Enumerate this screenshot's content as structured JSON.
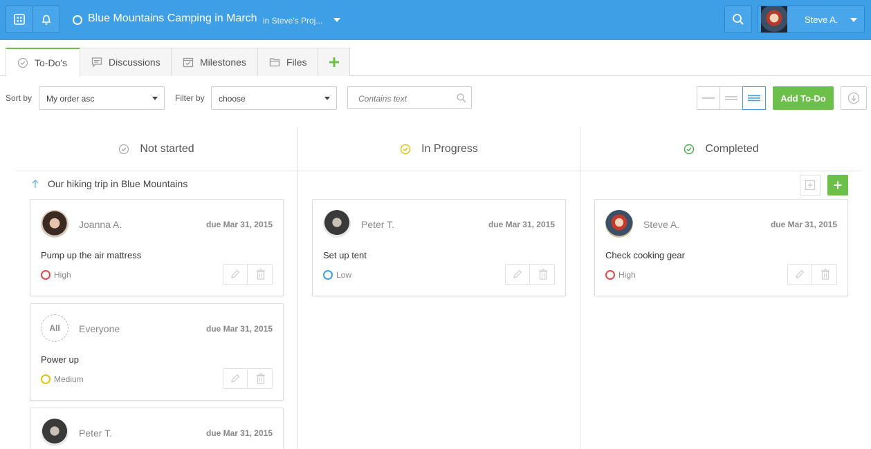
{
  "topbar": {
    "project_title": "Blue Mountains Camping in March",
    "project_sub": "in Steve's Proj...",
    "user_name": "Steve A."
  },
  "tabs": [
    {
      "label": "To-Do's",
      "icon": "check-circle-icon"
    },
    {
      "label": "Discussions",
      "icon": "chat-icon"
    },
    {
      "label": "Milestones",
      "icon": "calendar-icon"
    },
    {
      "label": "Files",
      "icon": "folder-icon"
    }
  ],
  "filters": {
    "sort_label": "Sort by",
    "sort_value": "My order asc",
    "filter_label": "Filter by",
    "filter_value": "choose",
    "search_placeholder": "Contains text",
    "add_todo_label": "Add To-Do"
  },
  "columns": [
    {
      "label": "Not started",
      "icon_color": "#aaaaaa"
    },
    {
      "label": "In Progress",
      "icon_color": "#e2c30f"
    },
    {
      "label": "Completed",
      "icon_color": "#4cae4c"
    }
  ],
  "group": {
    "title": "Our hiking trip in Blue Mountains"
  },
  "cards": [
    {
      "assignee": "Joanna A.",
      "due": "due Mar 31, 2015",
      "title": "Pump up the air mattress",
      "priority": "High",
      "priority_color": "#e24a4a"
    },
    {
      "assignee": "Everyone",
      "avatar_text": "All",
      "due": "due Mar 31, 2015",
      "title": "Power up",
      "priority": "Medium",
      "priority_color": "#e2c30f"
    },
    {
      "assignee": "Peter T.",
      "due": "due Mar 31, 2015"
    },
    {
      "assignee": "Peter T.",
      "due": "due Mar 31, 2015",
      "title": "Set up tent",
      "priority": "Low",
      "priority_color": "#3f9fe6"
    },
    {
      "assignee": "Steve A.",
      "due": "due Mar 31, 2015",
      "title": "Check cooking gear",
      "priority": "High",
      "priority_color": "#e24a4a"
    }
  ],
  "colors": {
    "brand_blue": "#3f9fe6",
    "accent_green": "#6cc04a"
  }
}
